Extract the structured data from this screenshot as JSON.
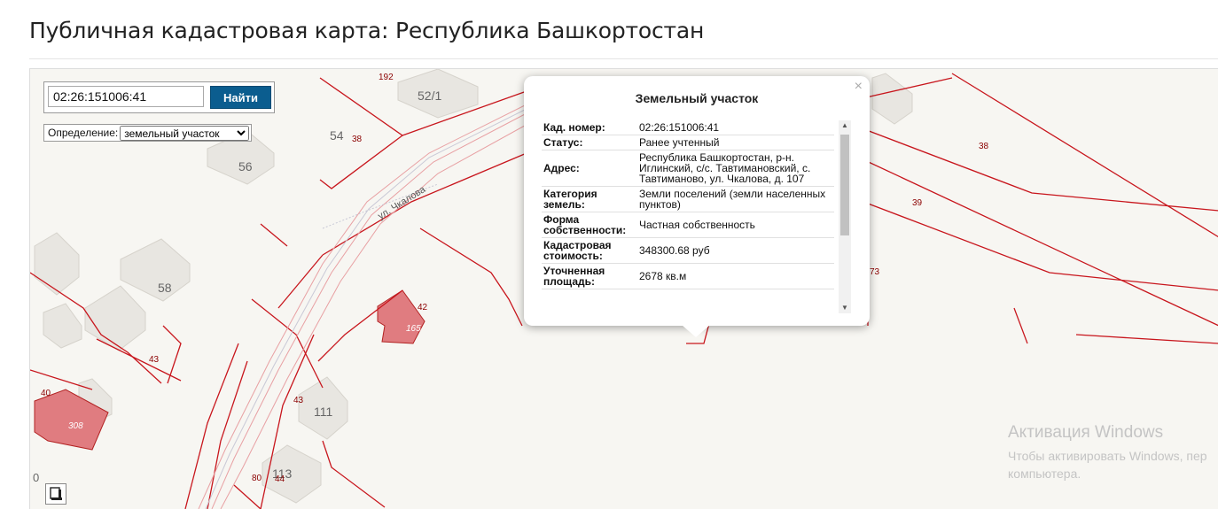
{
  "page": {
    "title": "Публичная кадастровая карта: Республика Башкортостан"
  },
  "search": {
    "value": "02:26:151006:41",
    "button_label": "Найти"
  },
  "definition": {
    "label": "Определение:",
    "selected": "земельный участок"
  },
  "popup": {
    "title": "Земельный участок",
    "close": "×",
    "rows": [
      {
        "key": "Кад. номер:",
        "value": "02:26:151006:41"
      },
      {
        "key": "Статус:",
        "value": "Ранее учтенный"
      },
      {
        "key": "Адрес:",
        "value": "Республика Башкортостан, р-н. Иглинский, с/с. Тавтимановский, с. Тавтиманово, ул. Чкалова, д. 107"
      },
      {
        "key": "Категория земель:",
        "value": "Земли поселений (земли населенных пунктов)"
      },
      {
        "key": "Форма собственности:",
        "value": "Частная собственность"
      },
      {
        "key": "Кадастровая стоимость:",
        "value": "348300.68 руб"
      },
      {
        "key": "Уточненная площадь:",
        "value": "2678 кв.м"
      }
    ]
  },
  "map": {
    "street_label": "ул. Чкалова",
    "building_numbers": [
      "52/1",
      "54",
      "56",
      "58",
      "111",
      "113"
    ],
    "parcel_labels": [
      "192",
      "38",
      "38",
      "39",
      "73",
      "42",
      "165",
      "43",
      "40",
      "308",
      "43",
      "80",
      "44",
      "0"
    ],
    "colors": {
      "parcel_line": "#c8161d",
      "highlight_fill": "#e07c80",
      "building_fill": "#e8e6e1",
      "background": "#f7f6f2"
    }
  },
  "watermark": {
    "title": "Активация Windows",
    "line1": "Чтобы активировать Windows, пер",
    "line2": "компьютера."
  },
  "icons": {
    "layers": "layers-icon",
    "close": "close-icon"
  }
}
